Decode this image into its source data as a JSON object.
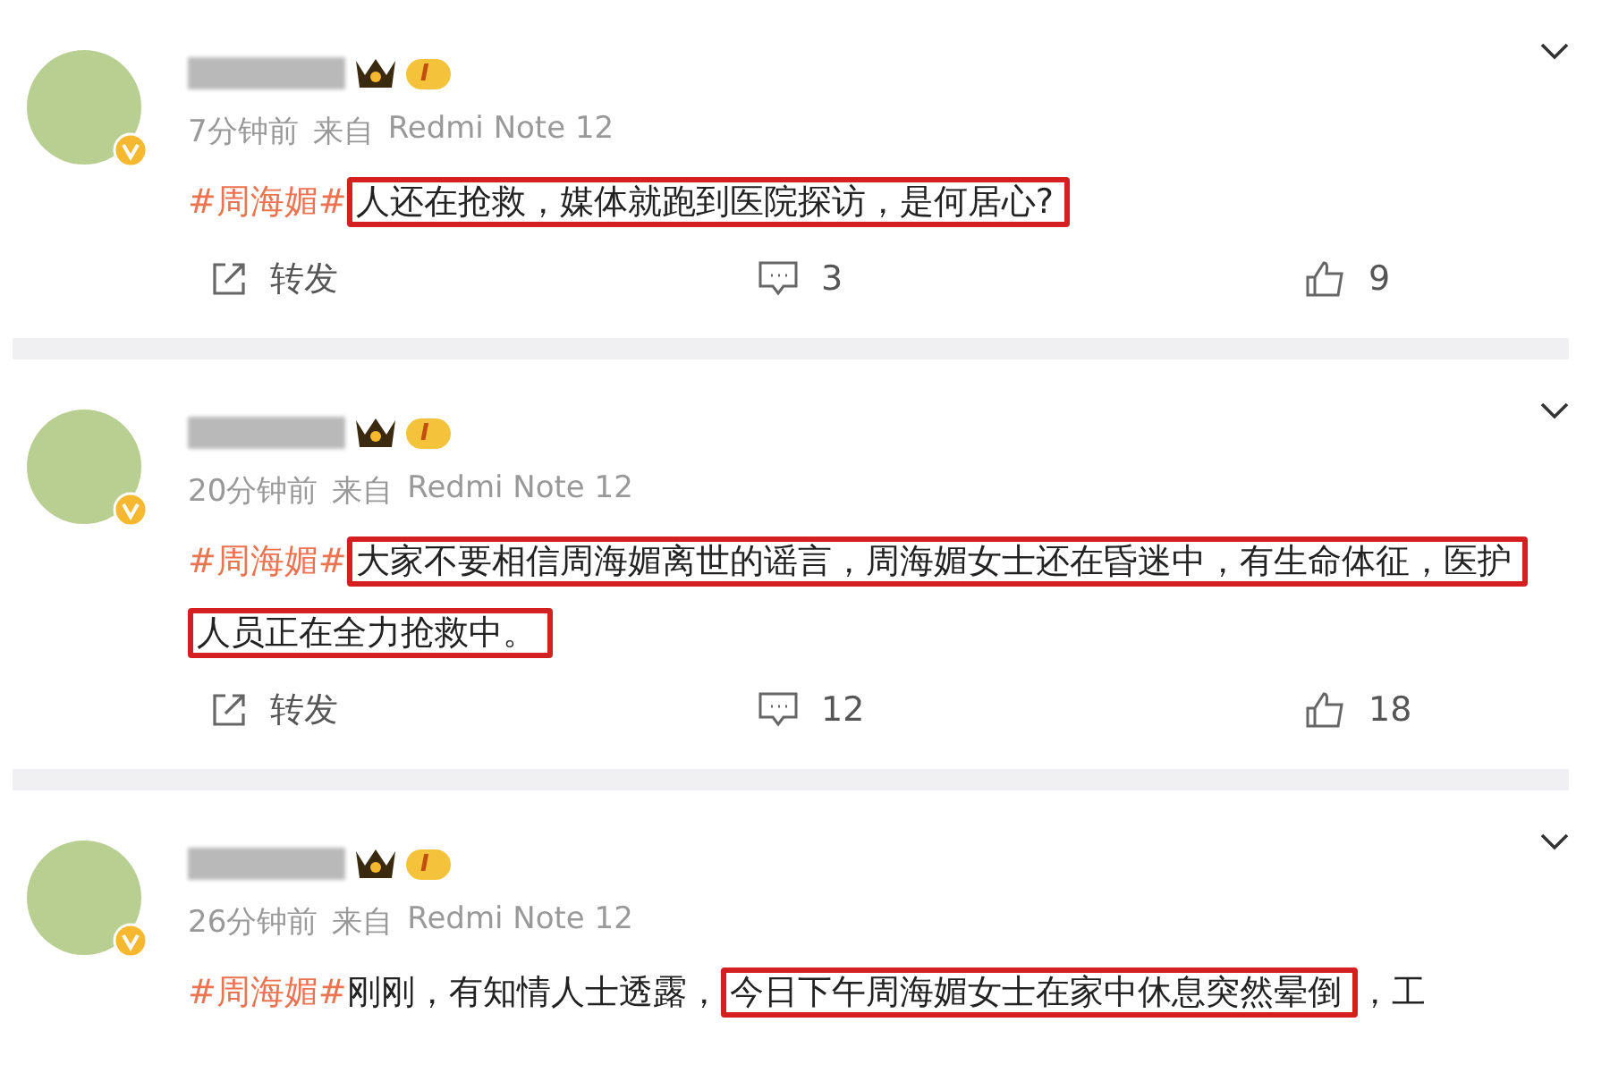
{
  "posts": [
    {
      "level_badge": "I",
      "verified": true,
      "time": "7分钟前",
      "source_label": "来自",
      "device": "Redmi Note 12",
      "hashtag": "#周海媚#",
      "segments": [
        {
          "text": "人还在抢救，媒体就跑到医院探访，是何居心?",
          "highlighted": true
        }
      ],
      "actions": {
        "repost": "转发",
        "comments": "3",
        "likes": "9"
      }
    },
    {
      "level_badge": "I",
      "verified": true,
      "time": "20分钟前",
      "source_label": "来自",
      "device": "Redmi Note 12",
      "hashtag": "#周海媚#",
      "segments": [
        {
          "text": "大家不要相信周海媚离世的谣言，周海媚女士还在昏迷中，有生命体征，医护人员正在全力抢救中。",
          "highlighted": true
        }
      ],
      "actions": {
        "repost": "转发",
        "comments": "12",
        "likes": "18"
      }
    },
    {
      "level_badge": "I",
      "verified": true,
      "time": "26分钟前",
      "source_label": "来自",
      "device": "Redmi Note 12",
      "hashtag": "#周海媚#",
      "segments": [
        {
          "text": "刚刚，有知情人士透露，",
          "highlighted": false
        },
        {
          "text": "今日下午周海媚女士在家中休息突然晕倒",
          "highlighted": true
        },
        {
          "text": "，工",
          "highlighted": false
        }
      ]
    }
  ]
}
